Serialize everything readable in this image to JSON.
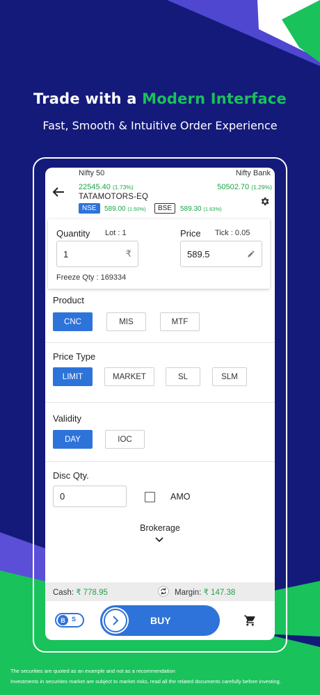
{
  "headline": {
    "lead": "Trade with a ",
    "accent": "Modern Interface"
  },
  "subline": "Fast, Smooth & Intuitive Order Experience",
  "header": {
    "index1_name": "Nifty 50",
    "index1_value": "22545.40",
    "index1_change": "(1.73%)",
    "index2_name": "Nifty Bank",
    "index2_value": "50502.70",
    "index2_change": "(1.29%)",
    "symbol": "TATAMOTORS-EQ",
    "nse_label": "NSE",
    "nse_price": "589.00",
    "nse_change": "(1.50%)",
    "bse_label": "BSE",
    "bse_price": "589.30",
    "bse_change": "(1.63%)"
  },
  "order": {
    "quantity_label": "Quantity",
    "lot_label": "Lot : 1",
    "quantity_value": "1",
    "rupee_symbol": "₹",
    "price_label": "Price",
    "tick_label": "Tick : 0.05",
    "price_value": "589.5",
    "freeze_qty": "Freeze Qty : 169334"
  },
  "product": {
    "title": "Product",
    "options": [
      "CNC",
      "MIS",
      "MTF"
    ],
    "selected": "CNC"
  },
  "price_type": {
    "title": "Price Type",
    "options": [
      "LIMIT",
      "MARKET",
      "SL",
      "SLM"
    ],
    "selected": "LIMIT"
  },
  "validity": {
    "title": "Validity",
    "options": [
      "DAY",
      "IOC"
    ],
    "selected": "DAY"
  },
  "disc": {
    "title": "Disc Qty.",
    "value": "0",
    "amo_label": "AMO"
  },
  "brokerage_label": "Brokerage",
  "funds": {
    "cash_label": "Cash: ",
    "cash_value": "₹ 778.95",
    "margin_label": "Margin: ",
    "margin_value": "₹ 147.38"
  },
  "actions": {
    "toggle_b": "B",
    "toggle_s": "S",
    "buy_label": "BUY"
  },
  "disclaimer1": "The securities are quoted as an example and not as a recommendation",
  "disclaimer2": "Investments in securities market are subject to market risks, read all the related documents carefully before investing.",
  "colors": {
    "background": "#141a7a",
    "accent_green": "#19c25a",
    "primary_blue": "#2e73d9",
    "purple": "#5a4fd6"
  }
}
